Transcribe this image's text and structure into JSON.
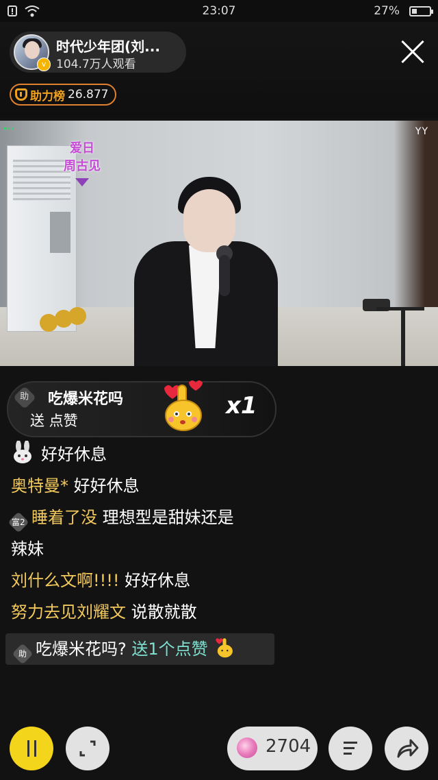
{
  "status_bar": {
    "time": "23:07",
    "battery": "27%"
  },
  "header": {
    "host_name": "时代少年团(刘...",
    "viewers": "104.7万人观看",
    "verified_mark": "v",
    "rank_label": "助力榜",
    "rank_value": "26.877"
  },
  "video": {
    "watermark": "YY",
    "logo_text_1": "爱日",
    "logo_text_2": "周古见"
  },
  "gift_banner": {
    "badge": "助",
    "user": "吃爆米花吗",
    "action": "送 点赞",
    "count": "x1",
    "emoji": "👆"
  },
  "chat": [
    {
      "user": "",
      "message": "好好休息",
      "badge": "bunny-icon"
    },
    {
      "user": "奥特曼*",
      "message": "好好休息"
    },
    {
      "user": "睡着了没",
      "message": "理想型是甜妹还是",
      "badge": "富2"
    },
    {
      "user": "",
      "message": "辣妹"
    },
    {
      "user": "刘什么文啊!!!!",
      "message": "好好休息"
    },
    {
      "user": "努力去见刘耀文",
      "message": "说散就散"
    }
  ],
  "gift_line": {
    "badge": "助",
    "user": "吃爆米花吗?",
    "action": "送1个点赞"
  },
  "bottom_bar": {
    "coins": "2704"
  },
  "colors": {
    "accent_yellow": "#f3d51b",
    "username_gold": "#f3c95c",
    "gift_teal": "#7fe0d2",
    "rank_orange": "#e0812f"
  }
}
